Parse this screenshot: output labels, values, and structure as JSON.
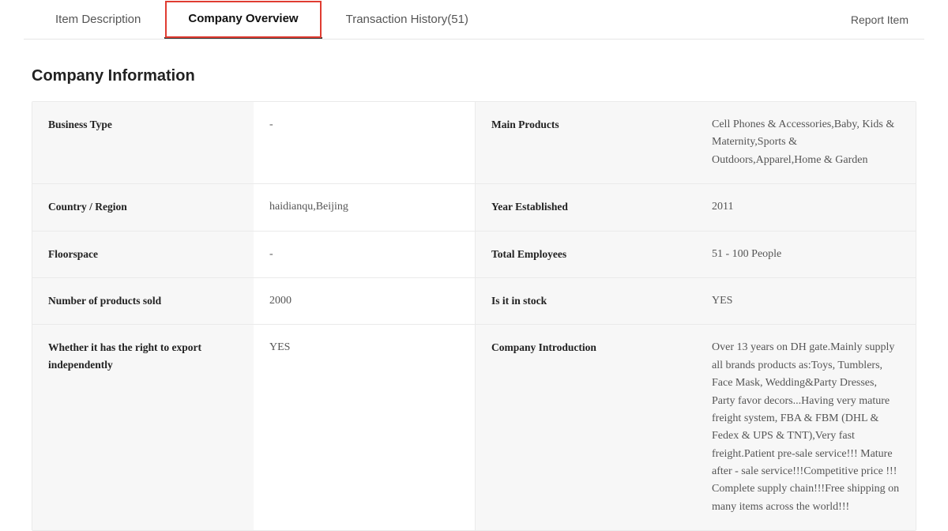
{
  "tabs": {
    "item_description": "Item Description",
    "company_overview": "Company Overview",
    "transaction_history": "Transaction History(51)"
  },
  "report_item": "Report Item",
  "section_title": "Company Information",
  "fields": {
    "business_type": {
      "label": "Business Type",
      "value": "-"
    },
    "main_products": {
      "label": "Main Products",
      "value": "Cell Phones & Accessories,Baby, Kids & Maternity,Sports & Outdoors,Apparel,Home & Garden"
    },
    "country_region": {
      "label": "Country / Region",
      "value": "haidianqu,Beijing"
    },
    "year_established": {
      "label": "Year Established",
      "value": "2011"
    },
    "floorspace": {
      "label": "Floorspace",
      "value": "-"
    },
    "total_employees": {
      "label": "Total Employees",
      "value": "51 - 100 People"
    },
    "products_sold": {
      "label": "Number of products sold",
      "value": "2000"
    },
    "in_stock": {
      "label": "Is it in stock",
      "value": "YES"
    },
    "export_right": {
      "label": "Whether it has the right to export independently",
      "value": "YES"
    },
    "introduction": {
      "label": "Company Introduction",
      "value": "Over 13 years on DH gate.Mainly supply all brands products as:Toys, Tumblers, Face Mask, Wedding&Party Dresses, Party favor decors...Having very mature freight system, FBA & FBM (DHL & Fedex & UPS & TNT),Very fast freight.Patient pre-sale service!!! Mature after - sale service!!!Competitive price !!! Complete supply chain!!!Free shipping on many items across the world!!!"
    }
  }
}
